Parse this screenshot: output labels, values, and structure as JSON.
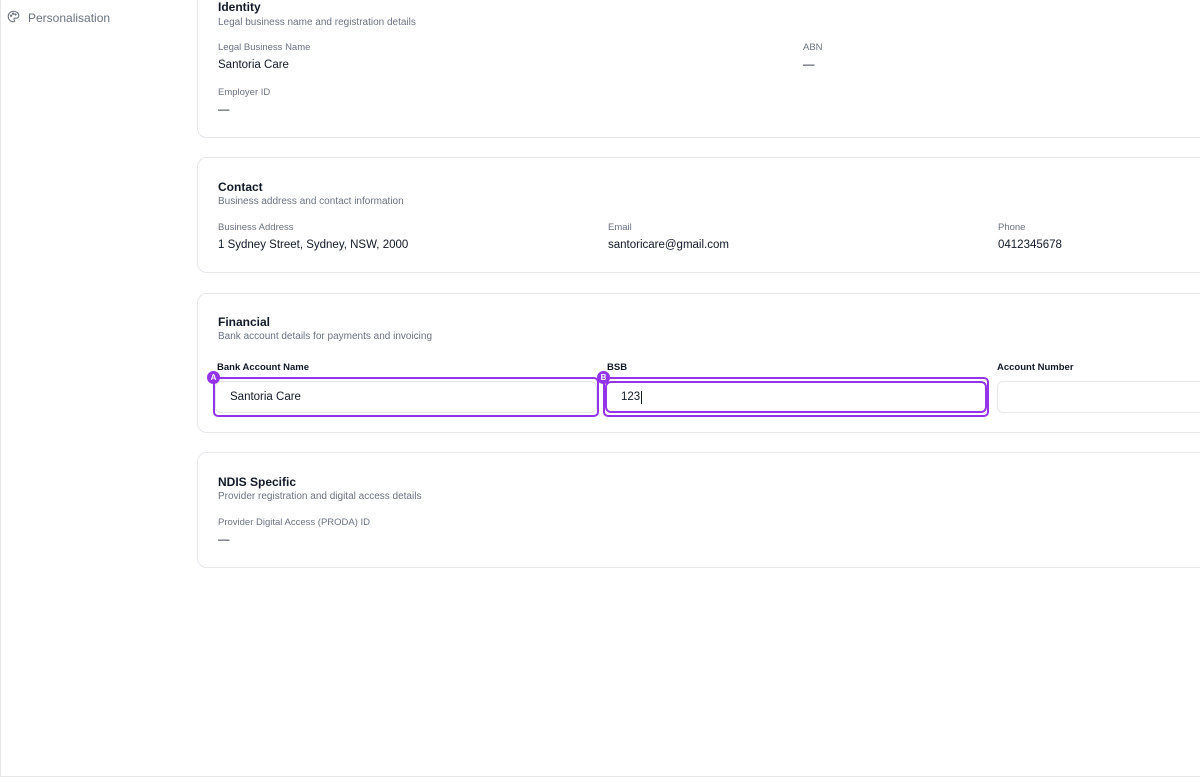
{
  "sidebar": {
    "items": [
      {
        "label": "Personalisation",
        "icon": "palette-icon"
      }
    ]
  },
  "identity": {
    "title": "Identity",
    "subtitle": "Legal business name and registration details",
    "legal_name_label": "Legal Business Name",
    "legal_name_value": "Santoria Care",
    "abn_label": "ABN",
    "abn_value": "—",
    "employer_id_label": "Employer ID",
    "employer_id_value": "—"
  },
  "contact": {
    "title": "Contact",
    "subtitle": "Business address and contact information",
    "address_label": "Business Address",
    "address_value": "1 Sydney Street, Sydney, NSW, 2000",
    "email_label": "Email",
    "email_value": "santoricare@gmail.com",
    "phone_label": "Phone",
    "phone_value": "0412345678"
  },
  "financial": {
    "title": "Financial",
    "subtitle": "Bank account details for payments and invoicing",
    "bank_account_name_label": "Bank Account Name",
    "bank_account_name_value": "Santoria Care",
    "bsb_label": "BSB",
    "bsb_value": "123",
    "account_number_label": "Account Number",
    "account_number_value": ""
  },
  "ndis": {
    "title": "NDIS Specific",
    "subtitle": "Provider registration and digital access details",
    "proda_label": "Provider Digital Access (PRODA) ID",
    "proda_value": "—"
  },
  "markers": {
    "a": "A",
    "b": "B"
  },
  "colors": {
    "highlight": "#9333ea",
    "border": "#e5e7eb",
    "muted_text": "#6b7280"
  }
}
